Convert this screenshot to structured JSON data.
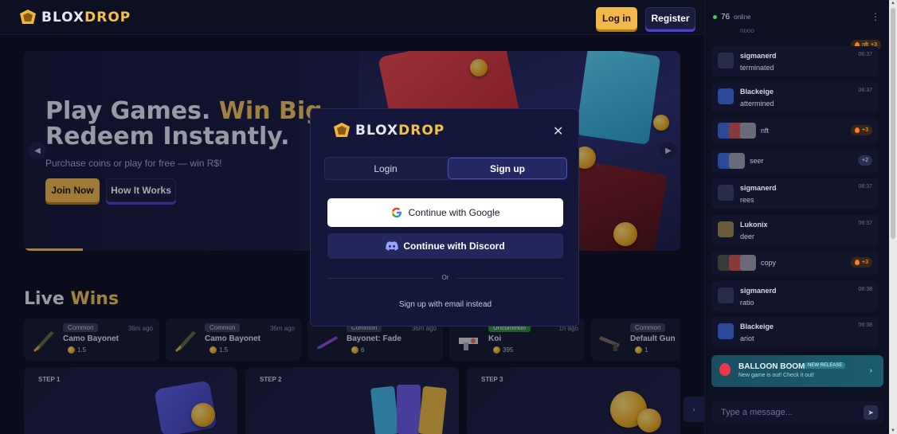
{
  "header": {
    "logo_text_a": "BLOX",
    "logo_text_b": "DROP",
    "login_label": "Log in",
    "register_label": "Register"
  },
  "hero": {
    "title_line1_a": "Play Games.",
    "title_line1_b": "Win Big.",
    "title_line2": "Redeem Instantly.",
    "subtitle": "Purchase coins or play for free — win R$!",
    "join_label": "Join Now",
    "how_label": "How It Works",
    "slide_progress": 0.09
  },
  "live_wins": {
    "title_a": "Live",
    "title_b": "Wins",
    "items": [
      {
        "rarity": "Common",
        "time": "36m ago",
        "name": "Camo Bayonet",
        "value": "1.5"
      },
      {
        "rarity": "Common",
        "time": "36m ago",
        "name": "Camo Bayonet",
        "value": "1.5"
      },
      {
        "rarity": "Common",
        "time": "36m ago",
        "name": "Bayonet: Fade",
        "value": "6"
      },
      {
        "rarity": "Uncommon",
        "time": "1h ago",
        "name": "Koi",
        "value": "395"
      },
      {
        "rarity": "Common",
        "time": "",
        "name": "Default Gun",
        "value": "1"
      }
    ]
  },
  "steps": [
    {
      "label": "STEP 1"
    },
    {
      "label": "STEP 2"
    },
    {
      "label": "STEP 3"
    }
  ],
  "modal": {
    "logo_text_a": "BLOX",
    "logo_text_b": "DROP",
    "tab_login": "Login",
    "tab_signup": "Sign up",
    "google_label": "Continue with Google",
    "discord_label": "Continue with Discord",
    "or_text": "Or",
    "email_link": "Sign up with email instead"
  },
  "chat": {
    "online_count": "76",
    "online_label": "online",
    "top_fade_text": "nooo",
    "messages": [
      {
        "user": "",
        "text": "",
        "pill": "+3",
        "pill_label": "nft",
        "time": ""
      },
      {
        "user": "sigmanerd",
        "text": "terminated",
        "time": "06:37"
      },
      {
        "user": "Blackeige",
        "text": "attermined",
        "time": "06:37"
      },
      {
        "user": "",
        "text": "nft",
        "pill": "+3",
        "time": ""
      },
      {
        "user": "",
        "text": "seer",
        "pill": "+2",
        "time": ""
      },
      {
        "user": "sigmanerd",
        "text": "rees",
        "time": "06:37"
      },
      {
        "user": "Lukonix",
        "text": "deer",
        "time": "06:37"
      },
      {
        "user": "",
        "text": "copy",
        "pill": "+3",
        "time": ""
      },
      {
        "user": "sigmanerd",
        "text": "ratio",
        "time": "06:38"
      },
      {
        "user": "Blackeige",
        "text": "ariot",
        "time": "06:38"
      }
    ],
    "promo_title": "BALLOON BOOM",
    "promo_badge": "NEW RELEASE",
    "promo_sub": "New game is out! Check it out!",
    "input_placeholder": "Type a message..."
  },
  "colors": {
    "accent_gold": "#f3c257",
    "accent_purple": "#4b3fd6",
    "bg": "#0c0e1f",
    "online_green": "#3ccf6a"
  }
}
